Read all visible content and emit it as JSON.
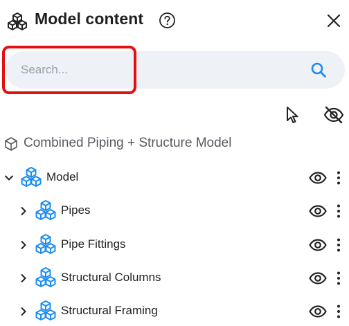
{
  "header": {
    "title": "Model content",
    "logo_icon": "cubes-outline-icon",
    "help_icon": "help-circle-icon",
    "close_icon": "close-icon"
  },
  "search": {
    "placeholder": "Search...",
    "value": "",
    "button_icon": "search-icon",
    "highlighted": true,
    "highlight_color": "#e4100f"
  },
  "toolbar": {
    "select_icon": "cursor-icon",
    "visibility_icon": "eye-off-icon"
  },
  "root": {
    "label": "Combined Piping + Structure Model",
    "icon": "cube-outline-icon"
  },
  "tree": [
    {
      "label": "Model",
      "expanded": true,
      "level": 0
    },
    {
      "label": "Pipes",
      "expanded": false,
      "level": 1
    },
    {
      "label": "Pipe Fittings",
      "expanded": false,
      "level": 1
    },
    {
      "label": "Structural Columns",
      "expanded": false,
      "level": 1
    },
    {
      "label": "Structural Framing",
      "expanded": false,
      "level": 1
    }
  ],
  "colors": {
    "accent": "#1a8cf0",
    "search_bg": "#eef1f6",
    "text": "#222222"
  }
}
